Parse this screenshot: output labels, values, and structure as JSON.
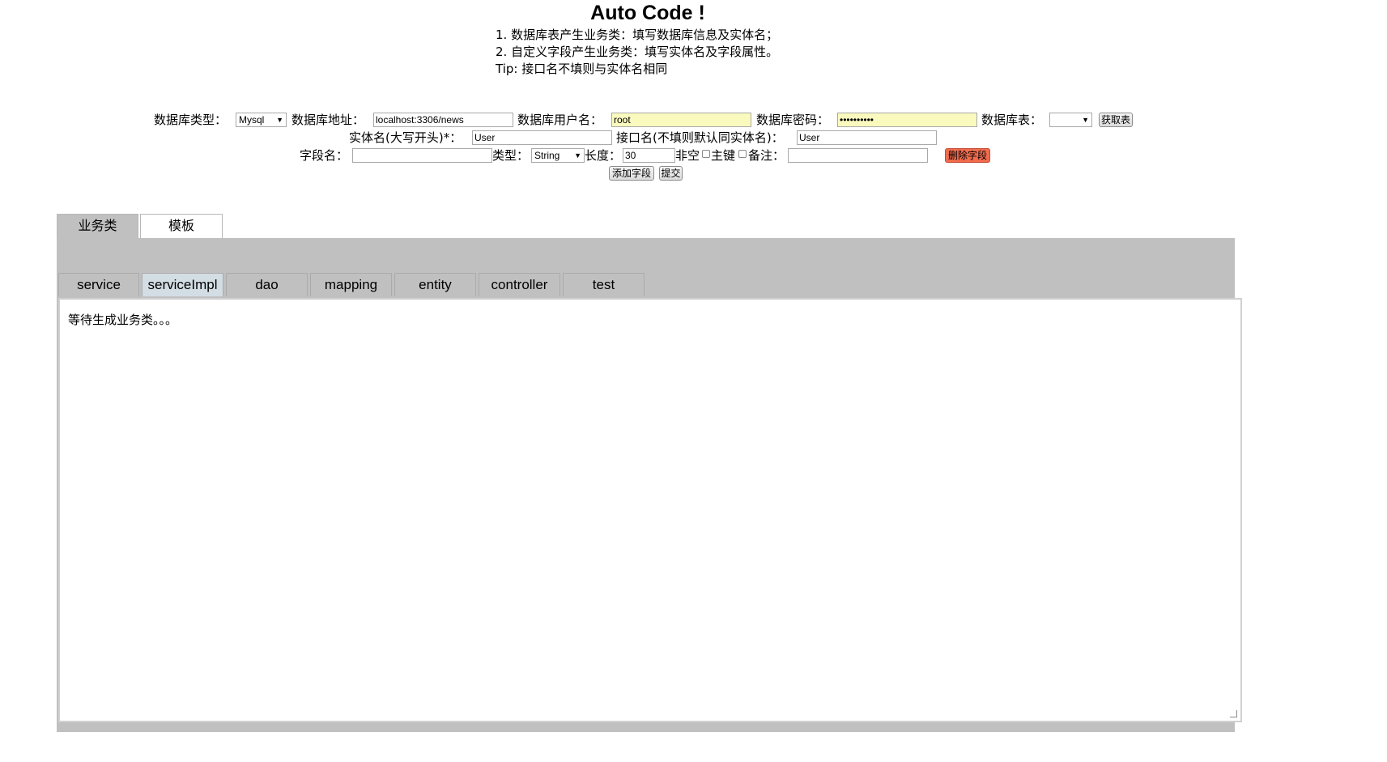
{
  "header": {
    "title": "Auto Code !",
    "instructions": [
      "1. 数据库表产生业务类：填写数据库信息及实体名；",
      "2. 自定义字段产生业务类：填写实体名及字段属性。",
      "Tip: 接口名不填则与实体名相同"
    ]
  },
  "form": {
    "db_type_label": "数据库类型：",
    "db_type_value": "Mysql",
    "db_url_label": "数据库地址：",
    "db_url_value": "localhost:3306/news",
    "db_user_label": "数据库用户名：",
    "db_user_value": "root",
    "db_password_label": "数据库密码：",
    "db_password_value": "••••••••••",
    "db_table_label": "数据库表：",
    "db_table_value": "",
    "get_tables_button": "获取表",
    "entity_label": "实体名(大写开头)*：",
    "entity_value": "User",
    "interface_label": "接口名(不填则默认同实体名)：",
    "interface_value": "User",
    "field_name_label": "字段名：",
    "field_name_value": "",
    "field_type_label": "类型：",
    "field_type_value": "String",
    "length_label": "长度：",
    "length_value": "30",
    "not_null_label": "非空",
    "primary_key_label": "主键",
    "remark_label": "备注：",
    "remark_value": "",
    "delete_field_button": "删除字段",
    "add_field_button": "添加字段",
    "submit_button": "提交"
  },
  "top_tabs": [
    {
      "label": "业务类"
    },
    {
      "label": "模板"
    }
  ],
  "sub_tabs": [
    {
      "label": "service"
    },
    {
      "label": "serviceImpl"
    },
    {
      "label": "dao"
    },
    {
      "label": "mapping"
    },
    {
      "label": "entity"
    },
    {
      "label": "controller"
    },
    {
      "label": "test"
    }
  ],
  "output": {
    "text": "等待生成业务类。。。"
  }
}
